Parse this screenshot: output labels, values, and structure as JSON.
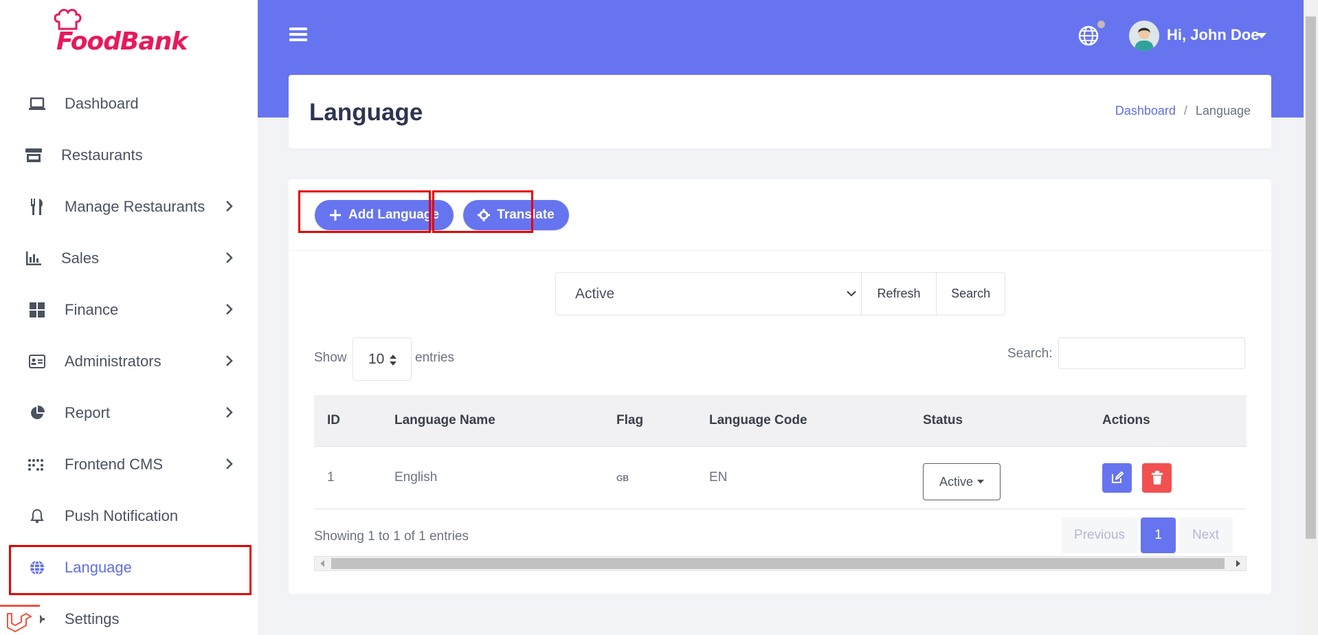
{
  "brand": {
    "logo_text": "FoodBank"
  },
  "colors": {
    "accent": "#6675ef",
    "brand": "#e8195a",
    "highlight": "#e60000",
    "danger": "#f25050"
  },
  "sidebar": {
    "items": [
      {
        "label": "Dashboard",
        "icon": "laptop-icon",
        "has_children": false
      },
      {
        "label": "Restaurants",
        "icon": "store-icon",
        "has_children": false
      },
      {
        "label": "Manage Restaurants",
        "icon": "utensils-icon",
        "has_children": true
      },
      {
        "label": "Sales",
        "icon": "bar-chart-icon",
        "has_children": true
      },
      {
        "label": "Finance",
        "icon": "grid-icon",
        "has_children": true
      },
      {
        "label": "Administrators",
        "icon": "id-card-icon",
        "has_children": true
      },
      {
        "label": "Report",
        "icon": "pie-chart-icon",
        "has_children": true
      },
      {
        "label": "Frontend CMS",
        "icon": "dots-grid-icon",
        "has_children": true
      },
      {
        "label": "Push Notification",
        "icon": "bell-icon",
        "has_children": false
      },
      {
        "label": "Language",
        "icon": "globe-icon",
        "has_children": false,
        "active": true
      },
      {
        "label": "Settings",
        "icon": "cog-icon",
        "has_children": false
      }
    ]
  },
  "header": {
    "user_greeting": "Hi, John Doe"
  },
  "page": {
    "title": "Language",
    "breadcrumb": {
      "home": "Dashboard",
      "sep": "/",
      "current": "Language"
    }
  },
  "toolbar": {
    "add_label": "Add Language",
    "translate_label": "Translate"
  },
  "filter": {
    "selected": "Active",
    "refresh_label": "Refresh",
    "search_label": "Search"
  },
  "table_controls": {
    "show_label": "Show",
    "entries_value": "10",
    "entries_label": "entries",
    "search_label": "Search:"
  },
  "table": {
    "columns": [
      "ID",
      "Language Name",
      "Flag",
      "Language Code",
      "Status",
      "Actions"
    ],
    "rows": [
      {
        "id": "1",
        "name": "English",
        "flag": "GB",
        "code": "EN",
        "status": "Active"
      }
    ]
  },
  "footer": {
    "showing": "Showing 1 to 1 of 1 entries",
    "prev_label": "Previous",
    "page": "1",
    "next_label": "Next"
  }
}
